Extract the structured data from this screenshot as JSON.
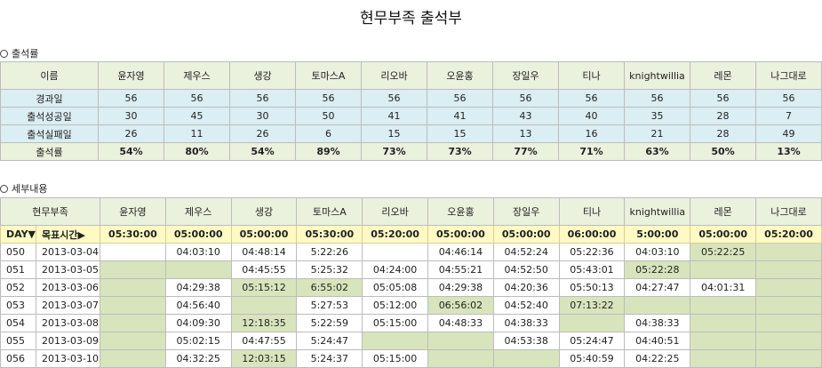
{
  "title": "현무부족 출석부",
  "section_attendance": "출석률",
  "section_detail": "세부내용",
  "names": [
    "윤자영",
    "제우스",
    "생강",
    "토마스A",
    "리오바",
    "오윤홍",
    "장일우",
    "티나",
    "knightwillia",
    "레몬",
    "나그대로"
  ],
  "summary": {
    "name_header": "이름",
    "rows": [
      {
        "label": "경과일",
        "values": [
          "56",
          "56",
          "56",
          "56",
          "56",
          "56",
          "56",
          "56",
          "56",
          "56",
          "56"
        ]
      },
      {
        "label": "출석성공일",
        "values": [
          "30",
          "45",
          "30",
          "50",
          "41",
          "41",
          "43",
          "40",
          "35",
          "28",
          "7"
        ]
      },
      {
        "label": "출석실패일",
        "values": [
          "26",
          "11",
          "26",
          "6",
          "15",
          "15",
          "13",
          "16",
          "21",
          "28",
          "49"
        ]
      },
      {
        "label": "출석률",
        "values": [
          "54%",
          "80%",
          "54%",
          "89%",
          "73%",
          "73%",
          "77%",
          "71%",
          "63%",
          "50%",
          "13%"
        ]
      }
    ]
  },
  "detail": {
    "tribe_header": "현무부족",
    "day_label": "DAY▼",
    "target_label": "목표시간▶",
    "targets": [
      "05:30:00",
      "05:00:00",
      "05:00:00",
      "05:30:00",
      "05:20:00",
      "05:00:00",
      "05:00:00",
      "06:00:00",
      "5:00:00",
      "05:00:00",
      "05:20:00"
    ],
    "rows": [
      {
        "day": "050",
        "date": "2013-03-04",
        "times": [
          "",
          "04:03:10",
          "04:48:14",
          "5:22:26",
          "",
          "04:46:14",
          "04:52:24",
          "05:22:36",
          "04:03:10",
          "05:22:25",
          ""
        ]
      },
      {
        "day": "051",
        "date": "2013-03-05",
        "times": [
          "",
          "",
          "04:45:55",
          "5:25:32",
          "04:24:00",
          "04:55:21",
          "04:52:50",
          "05:43:01",
          "05:22:28",
          "",
          ""
        ]
      },
      {
        "day": "052",
        "date": "2013-03-06",
        "times": [
          "",
          "04:29:38",
          "05:15:12",
          "6:55:02",
          "05:05:08",
          "04:29:38",
          "04:20:36",
          "05:50:13",
          "04:27:47",
          "04:01:31",
          ""
        ]
      },
      {
        "day": "053",
        "date": "2013-03-07",
        "times": [
          "",
          "04:56:40",
          "",
          "5:27:53",
          "05:12:00",
          "06:56:02",
          "04:52:40",
          "07:13:22",
          "",
          "",
          ""
        ]
      },
      {
        "day": "054",
        "date": "2013-03-08",
        "times": [
          "",
          "04:09:30",
          "12:18:35",
          "5:22:59",
          "05:15:00",
          "04:48:33",
          "04:38:33",
          "",
          "04:38:33",
          "",
          ""
        ]
      },
      {
        "day": "055",
        "date": "2013-03-09",
        "times": [
          "",
          "05:02:15",
          "04:47:55",
          "5:24:47",
          "",
          "",
          "04:53:38",
          "05:24:47",
          "04:40:51",
          "",
          ""
        ]
      },
      {
        "day": "056",
        "date": "2013-03-10",
        "times": [
          "",
          "04:32:25",
          "12:03:15",
          "5:24:37",
          "05:15:00",
          "",
          "",
          "05:40:59",
          "04:22:25",
          "",
          ""
        ]
      }
    ],
    "green_cells": [
      [
        0,
        9
      ],
      [
        0,
        10
      ],
      [
        1,
        0
      ],
      [
        1,
        1
      ],
      [
        1,
        8
      ],
      [
        1,
        9
      ],
      [
        1,
        10
      ],
      [
        2,
        0
      ],
      [
        2,
        2
      ],
      [
        2,
        3
      ],
      [
        2,
        10
      ],
      [
        3,
        0
      ],
      [
        3,
        2
      ],
      [
        3,
        5
      ],
      [
        3,
        7
      ],
      [
        3,
        8
      ],
      [
        3,
        9
      ],
      [
        3,
        10
      ],
      [
        4,
        0
      ],
      [
        4,
        2
      ],
      [
        4,
        7
      ],
      [
        4,
        9
      ],
      [
        4,
        10
      ],
      [
        5,
        0
      ],
      [
        5,
        4
      ],
      [
        5,
        5
      ],
      [
        5,
        9
      ],
      [
        5,
        10
      ],
      [
        6,
        0
      ],
      [
        6,
        2
      ],
      [
        6,
        5
      ],
      [
        6,
        6
      ],
      [
        6,
        9
      ],
      [
        6,
        10
      ]
    ]
  }
}
